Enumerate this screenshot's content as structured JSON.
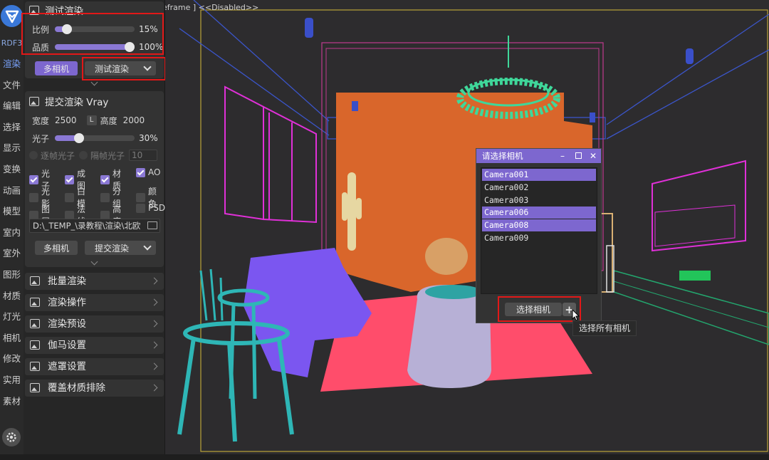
{
  "tabstrip": {
    "logo_text": "RDF3",
    "tabs": [
      "渲染",
      "文件",
      "编辑",
      "选择",
      "显示",
      "变换",
      "动画",
      "模型",
      "室内",
      "室外",
      "图形",
      "材质",
      "灯光",
      "相机",
      "修改",
      "实用",
      "素材"
    ]
  },
  "test_render": {
    "title": "测试渲染",
    "scale_label": "比例",
    "scale_value": "15%",
    "scale_fraction": 0.15,
    "quality_label": "品质",
    "quality_value": "100%",
    "quality_fraction": 1.0,
    "multi_camera": "多相机",
    "render_dropdown": "测试渲染"
  },
  "submit_render": {
    "title": "提交渲染 Vray",
    "width_label": "宽度",
    "width_value": "2500",
    "lock_label": "L",
    "height_label": "高度",
    "height_value": "2000",
    "photon_label": "光子",
    "photon_value": "30%",
    "photon_fraction": 0.3,
    "radio_every": "逐帧光子",
    "radio_skip": "隔帧光子",
    "frame_step": "10",
    "checkboxes": [
      {
        "label": "光子",
        "checked": true
      },
      {
        "label": "成图",
        "checked": true
      },
      {
        "label": "材质",
        "checked": true
      },
      {
        "label": "AO",
        "checked": true
      },
      {
        "label": "光影",
        "checked": false
      },
      {
        "label": "白模",
        "checked": false
      },
      {
        "label": "分组",
        "checked": false
      },
      {
        "label": "颜色",
        "checked": false
      },
      {
        "label": "图层",
        "checked": false
      },
      {
        "label": "法线",
        "checked": false
      },
      {
        "label": "高度",
        "checked": false
      },
      {
        "label": "PSD",
        "checked": false
      }
    ],
    "path": "D:\\_TEMP_\\录教程\\渲染\\北欧",
    "multi_camera": "多相机",
    "submit_dropdown": "提交渲染"
  },
  "collapsed_sections": [
    "批量渲染",
    "渲染操作",
    "渲染预设",
    "伽马设置",
    "遮罩设置",
    "覆盖材质排除"
  ],
  "viewport": {
    "label": "eframe ] <<Disabled>>"
  },
  "camera_dialog": {
    "title": "请选择相机",
    "cameras": [
      {
        "name": "Camera001",
        "selected": true
      },
      {
        "name": "Camera002",
        "selected": false
      },
      {
        "name": "Camera003",
        "selected": false
      },
      {
        "name": "Camera006",
        "selected": true
      },
      {
        "name": "Camera008",
        "selected": true
      },
      {
        "name": "Camera009",
        "selected": false
      }
    ],
    "select_button": "选择相机",
    "plus_button": "+",
    "tooltip": "选择所有相机"
  },
  "colors": {
    "accent": "#7d67cf",
    "highlight": "#e21818"
  }
}
